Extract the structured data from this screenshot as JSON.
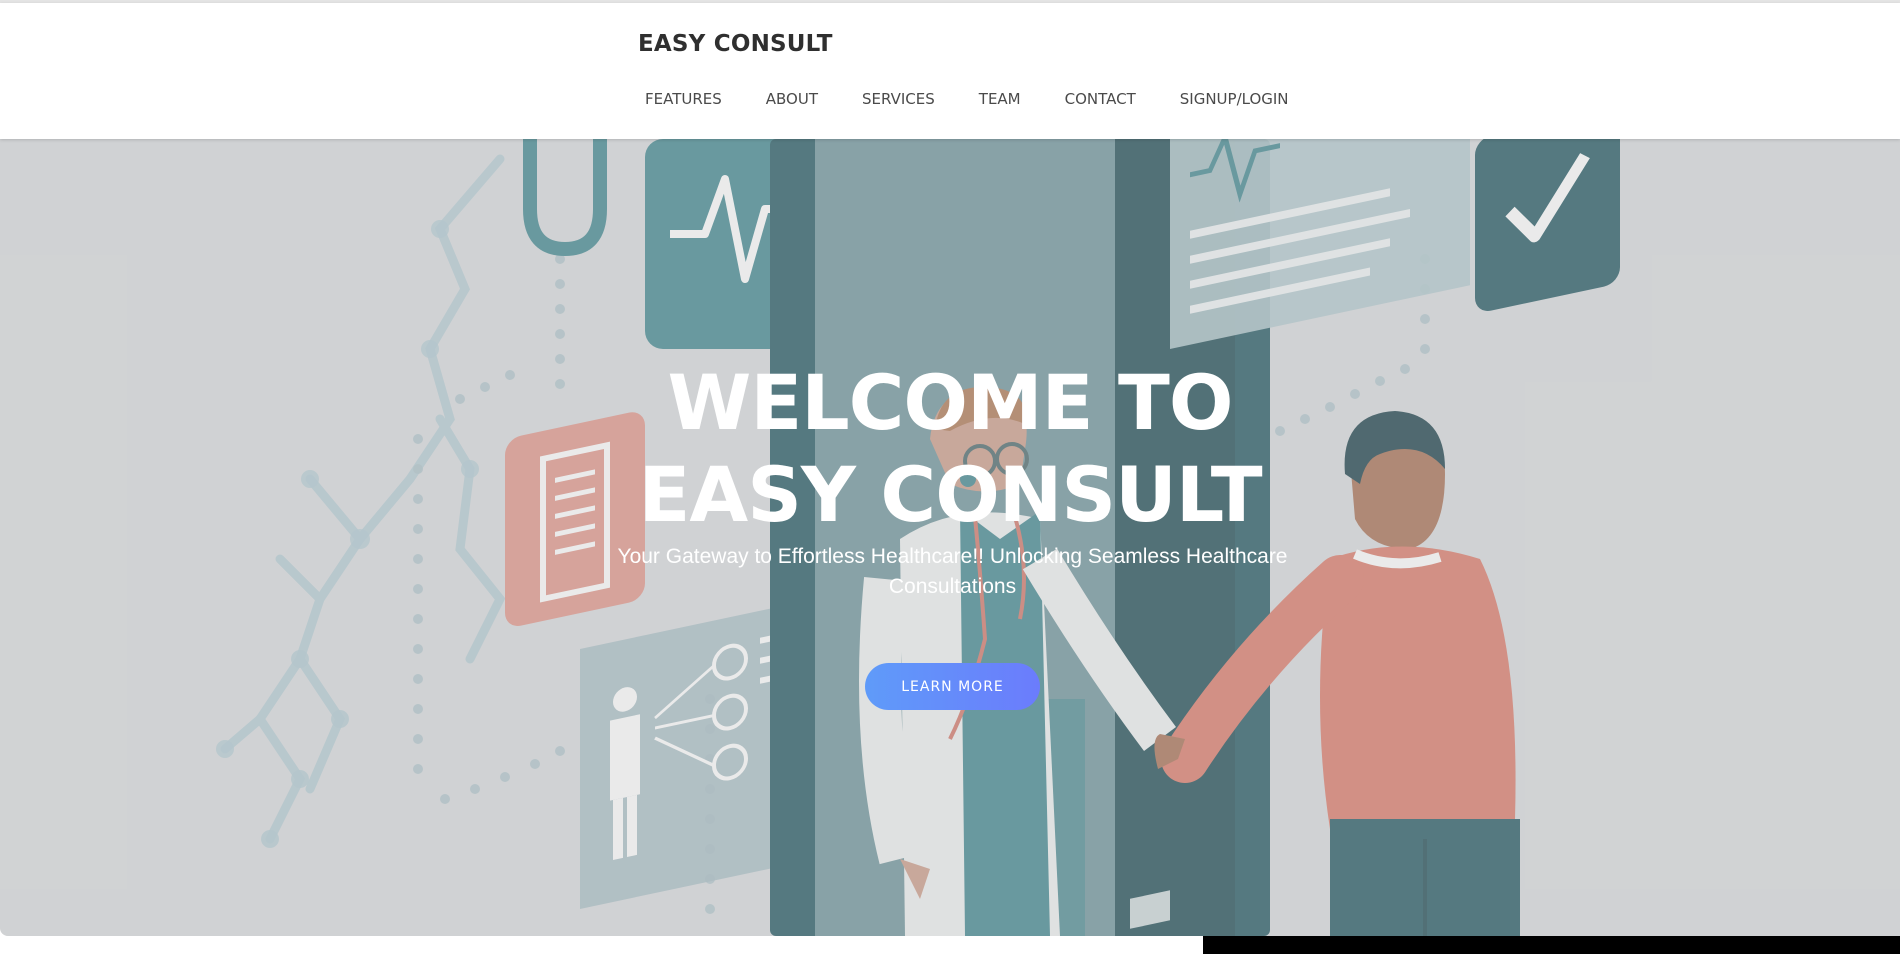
{
  "header": {
    "brand": "EASY CONSULT",
    "nav": [
      "FEATURES",
      "ABOUT",
      "SERVICES",
      "TEAM",
      "CONTACT",
      "SIGNUP/LOGIN"
    ]
  },
  "hero": {
    "title_line1": "WELCOME TO",
    "title_line2": "EASY CONSULT",
    "subtitle": "Your Gateway to Effortless Healthcare!! Unlocking Seamless Healthcare Consultations",
    "button_label": "LEARN MORE",
    "illustration": "doctor-patient-handshake-illustration"
  },
  "colors": {
    "accent_gradient_start": "#5f9bf9",
    "accent_gradient_end": "#6b7cfc",
    "teal": "#2f7d86",
    "dark_teal": "#0f4a55",
    "coral": "#d96e5c"
  }
}
